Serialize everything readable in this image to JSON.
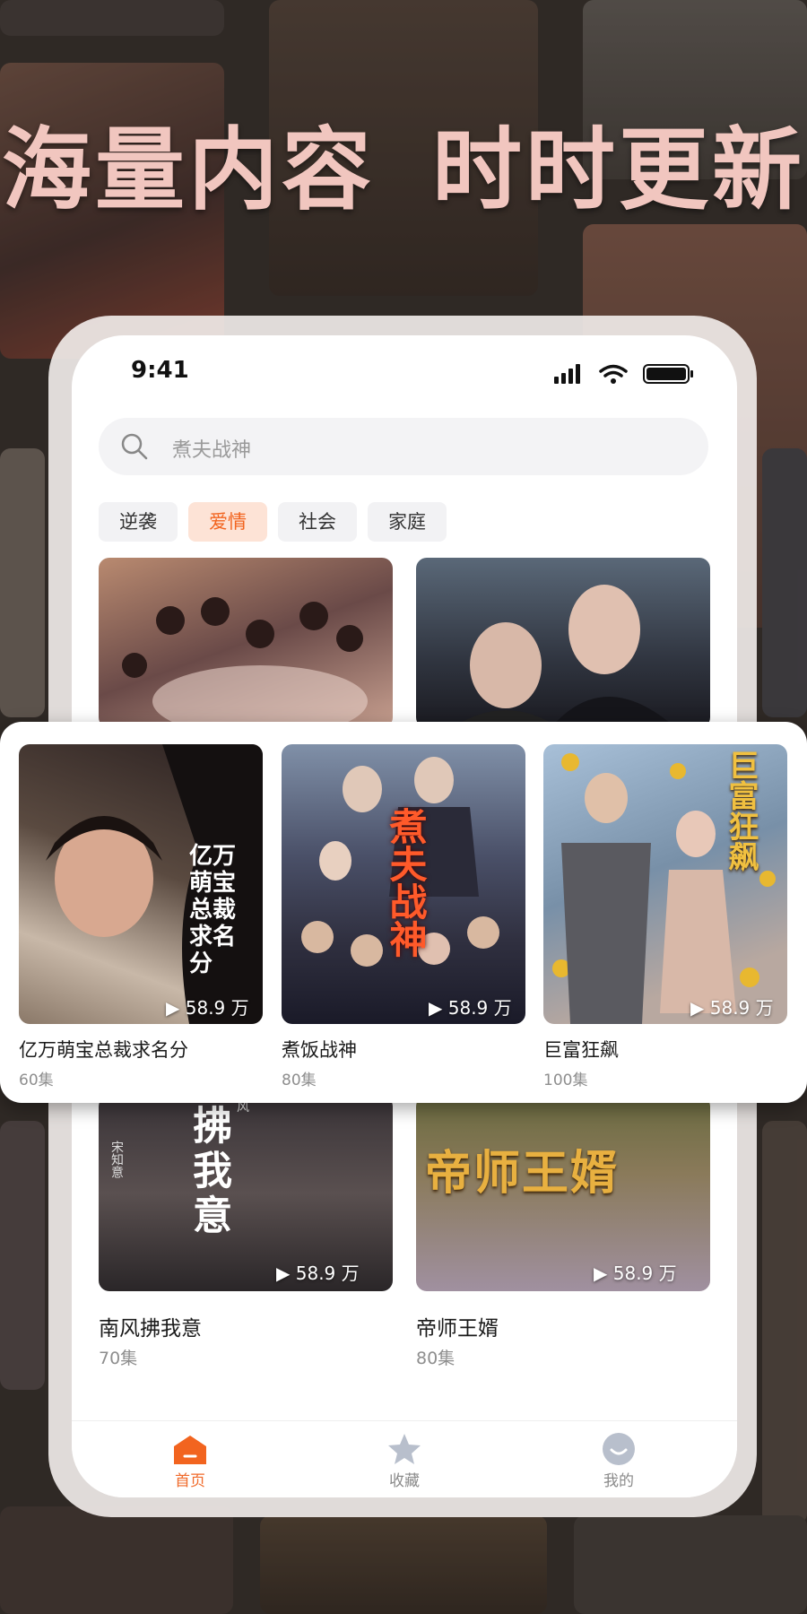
{
  "headline": {
    "part1": "海量内容",
    "part2": "时时更新"
  },
  "status_bar": {
    "time": "9:41"
  },
  "search": {
    "placeholder": "煮夫战神"
  },
  "tabs": [
    {
      "label": "逆袭",
      "active": false
    },
    {
      "label": "爱情",
      "active": true
    },
    {
      "label": "社会",
      "active": false
    },
    {
      "label": "家庭",
      "active": false
    }
  ],
  "featured": [
    {
      "title": "亿万萌宝总裁求名分",
      "episodes": "60集",
      "plays": "58.9 万",
      "poster_text": "亿万萌宝总裁求名分"
    },
    {
      "title": "煮饭战神",
      "episodes": "80集",
      "plays": "58.9 万",
      "poster_text": "煮夫战神"
    },
    {
      "title": "巨富狂飙",
      "episodes": "100集",
      "plays": "58.9 万",
      "poster_text": "巨富狂飙"
    }
  ],
  "grid_bottom": [
    {
      "title": "南风拂我意",
      "episodes": "70集",
      "plays": "58.9 万",
      "poster_text": "拂我意",
      "poster_small": "宋知意",
      "poster_small2": "风"
    },
    {
      "title": "帝师王婿",
      "episodes": "80集",
      "plays": "58.9 万",
      "poster_text": "帝师王婿"
    }
  ],
  "bottom_nav": [
    {
      "label": "首页",
      "icon": "home-icon",
      "active": true
    },
    {
      "label": "收藏",
      "icon": "star-icon",
      "active": false
    },
    {
      "label": "我的",
      "icon": "profile-icon",
      "active": false
    }
  ],
  "colors": {
    "accent": "#f2641f",
    "headline": "#f1c6bf",
    "tab_active_bg": "#fde3d6"
  }
}
